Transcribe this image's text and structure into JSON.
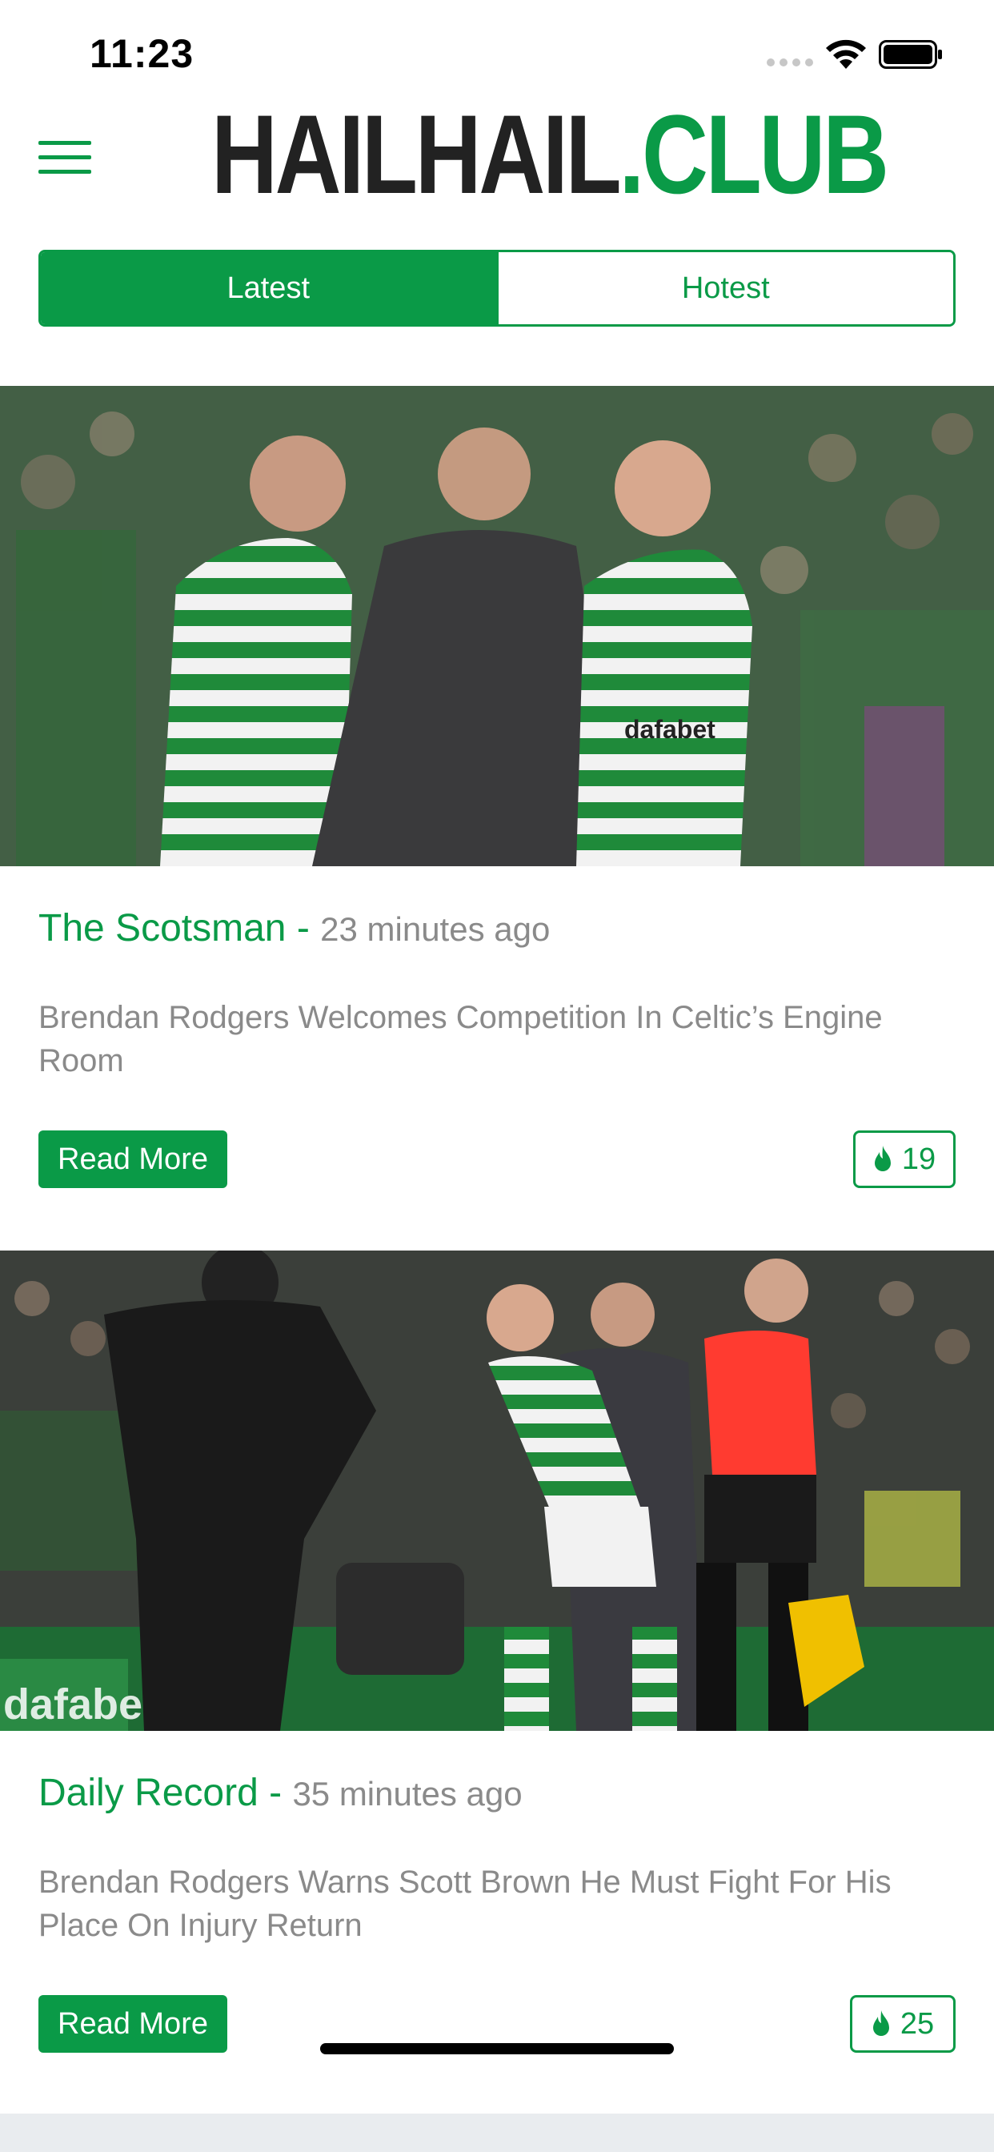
{
  "status_bar": {
    "time": "11:23"
  },
  "header": {
    "logo_part1": "HAILHAIL",
    "logo_part2": ".CLUB",
    "menu_icon": "hamburger-menu-icon",
    "accent_color": "#0a9a47"
  },
  "tabs": [
    {
      "label": "Latest",
      "active": true
    },
    {
      "label": "Hotest",
      "active": false
    }
  ],
  "articles": [
    {
      "image": "photo-celtic-players-celebrating-with-manager",
      "source": "The Scotsman",
      "separator": "-",
      "time": "23 minutes ago",
      "title": "Brendan Rodgers Welcomes Competition In Celtic’s Engine Room",
      "read_more": "Read More",
      "hot_count": "19",
      "hot_icon": "flame-icon"
    },
    {
      "image": "photo-celtic-captain-leaving-pitch-with-manager",
      "source": "Daily Record",
      "separator": "-",
      "time": "35 minutes ago",
      "title": "Brendan Rodgers Warns Scott Brown He Must Fight For His Place On Injury Return",
      "read_more": "Read More",
      "hot_count": "25",
      "hot_icon": "flame-icon"
    }
  ]
}
